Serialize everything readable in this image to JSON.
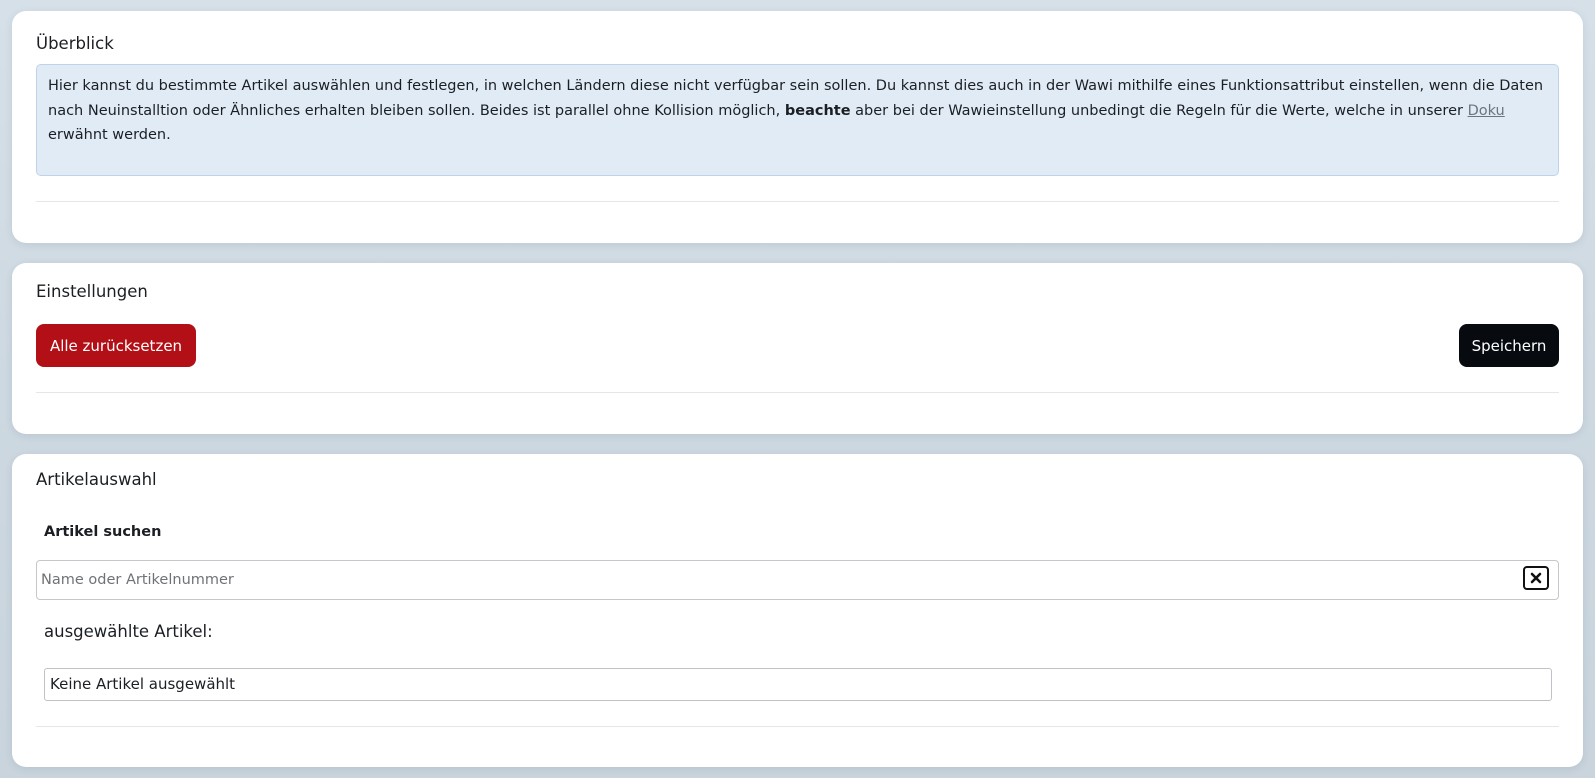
{
  "overview": {
    "title": "Überblick",
    "info_text_1": "Hier kannst du bestimmte Artikel auswählen und festlegen, in welchen Ländern diese nicht verfügbar sein sollen. Du kannst dies auch in der Wawi mithilfe eines Funktionsattribut einstellen, wenn die Daten nach Neuinstalltion oder Ähnliches erhalten bleiben sollen. Beides ist parallel ohne Kollision möglich,",
    "info_bold": "beachte",
    "info_text_2": "aber bei der Wawieinstellung unbedingt die Regeln für die Werte, welche in unserer",
    "doku_link": "Doku",
    "info_text_3": "erwähnt werden."
  },
  "settings": {
    "title": "Einstellungen",
    "reset_label": "Alle zurücksetzen",
    "save_label": "Speichern"
  },
  "articles": {
    "title": "Artikelauswahl",
    "search_label": "Artikel suchen",
    "search_placeholder": "Name oder Artikelnummer",
    "search_value": "",
    "selected_label": "ausgewählte Artikel:",
    "selected_empty": "Keine Artikel ausgewählt"
  },
  "colors": {
    "reset_button": "#b30f16",
    "save_button": "#070b10",
    "info_background": "#e1ebf6"
  },
  "icons": {
    "clear": "close-icon"
  }
}
